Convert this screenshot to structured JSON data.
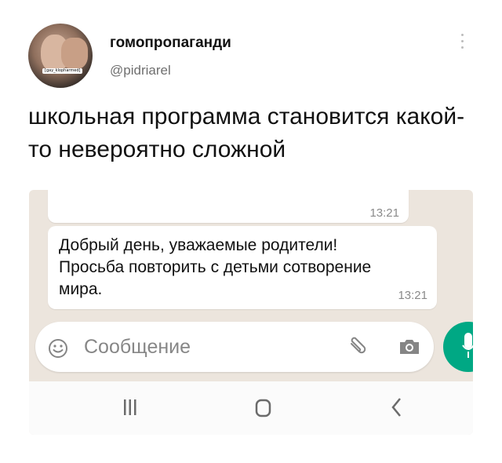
{
  "tweet": {
    "display_name": "гомопропаганди",
    "handle": "@pidriarel",
    "avatar_tag": "[gay_klopharmed]",
    "text": "школьная программа становится какой-то невероятно сложной"
  },
  "chat": {
    "previous_message_time": "13:21",
    "message_text": "Добрый день, уважаемые родители! Просьба повторить с детьми сотворение мира.",
    "message_time": "13:21",
    "input_placeholder": "Сообщение"
  },
  "colors": {
    "chat_background": "#ece5dd",
    "mic_button": "#00a884",
    "navbar": "#fbfbfb"
  },
  "icons": {
    "emoji": "emoji-icon",
    "attach": "attach-icon",
    "camera": "camera-icon",
    "mic": "mic-icon",
    "recents": "recents-icon",
    "home": "home-icon",
    "back": "back-icon",
    "more": "more-options-icon"
  }
}
